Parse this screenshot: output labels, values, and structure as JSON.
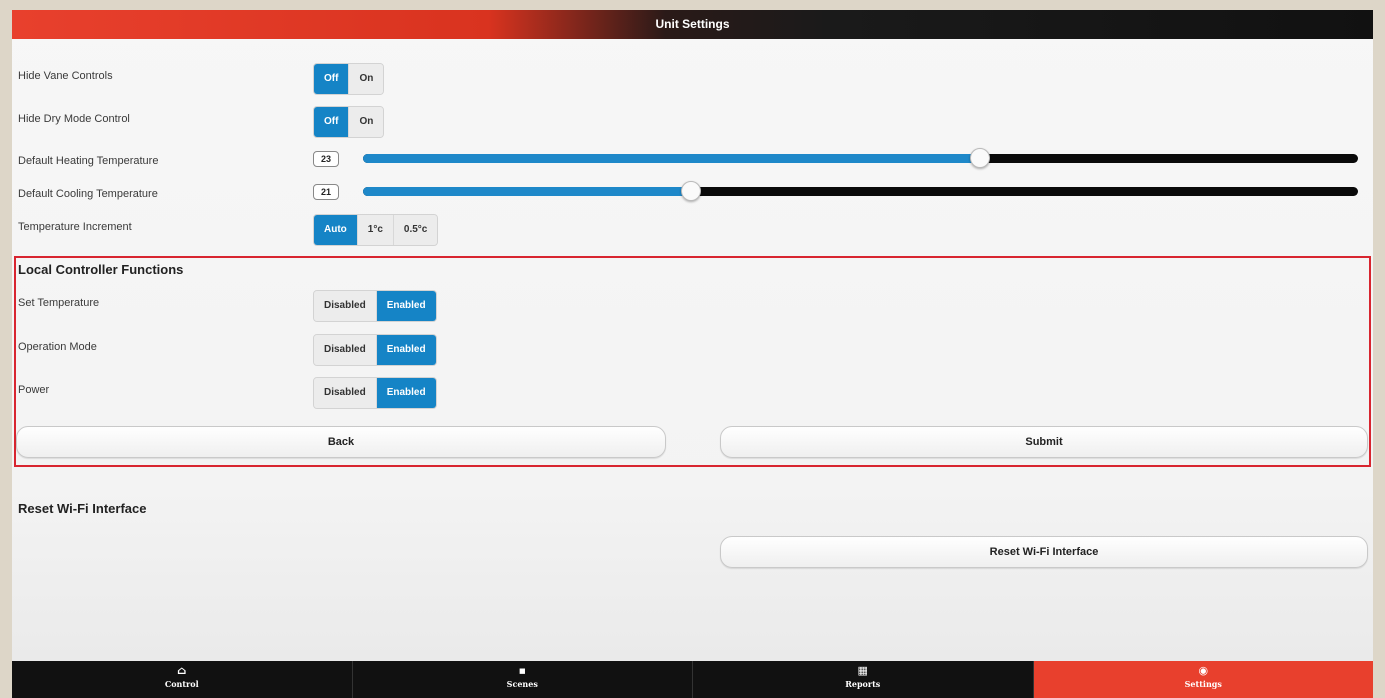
{
  "header": {
    "title": "Unit Settings"
  },
  "settings": {
    "hide_vane": {
      "label": "Hide Vane Controls",
      "options": [
        "Off",
        "On"
      ],
      "selected": "Off"
    },
    "hide_dry": {
      "label": "Hide Dry Mode Control",
      "options": [
        "Off",
        "On"
      ],
      "selected": "Off"
    },
    "heating": {
      "label": "Default Heating Temperature",
      "value": "23",
      "level_pct": 62
    },
    "cooling": {
      "label": "Default Cooling Temperature",
      "value": "21",
      "level_pct": 33
    },
    "increment": {
      "label": "Temperature Increment",
      "options": [
        "Auto",
        "1°c",
        "0.5°c"
      ],
      "selected": "Auto"
    }
  },
  "local_controller": {
    "title": "Local Controller Functions",
    "set_temperature": {
      "label": "Set Temperature",
      "options": [
        "Disabled",
        "Enabled"
      ],
      "selected": "Enabled"
    },
    "operation_mode": {
      "label": "Operation Mode",
      "options": [
        "Disabled",
        "Enabled"
      ],
      "selected": "Enabled"
    },
    "power": {
      "label": "Power",
      "options": [
        "Disabled",
        "Enabled"
      ],
      "selected": "Enabled"
    },
    "back_label": "Back",
    "submit_label": "Submit"
  },
  "reset": {
    "title": "Reset Wi-Fi Interface",
    "button_label": "Reset Wi-Fi Interface"
  },
  "nav": {
    "items": [
      {
        "label": "Control",
        "icon": "home-icon",
        "glyph": "⌂"
      },
      {
        "label": "Scenes",
        "icon": "video-icon",
        "glyph": "■"
      },
      {
        "label": "Reports",
        "icon": "grid-icon",
        "glyph": "▦"
      },
      {
        "label": "Settings",
        "icon": "settings-icon",
        "glyph": "◉"
      }
    ],
    "active": "Settings"
  },
  "colors": {
    "accent": "#1584c6",
    "brand_red": "#e8402d",
    "highlight_border": "#d8252f"
  }
}
